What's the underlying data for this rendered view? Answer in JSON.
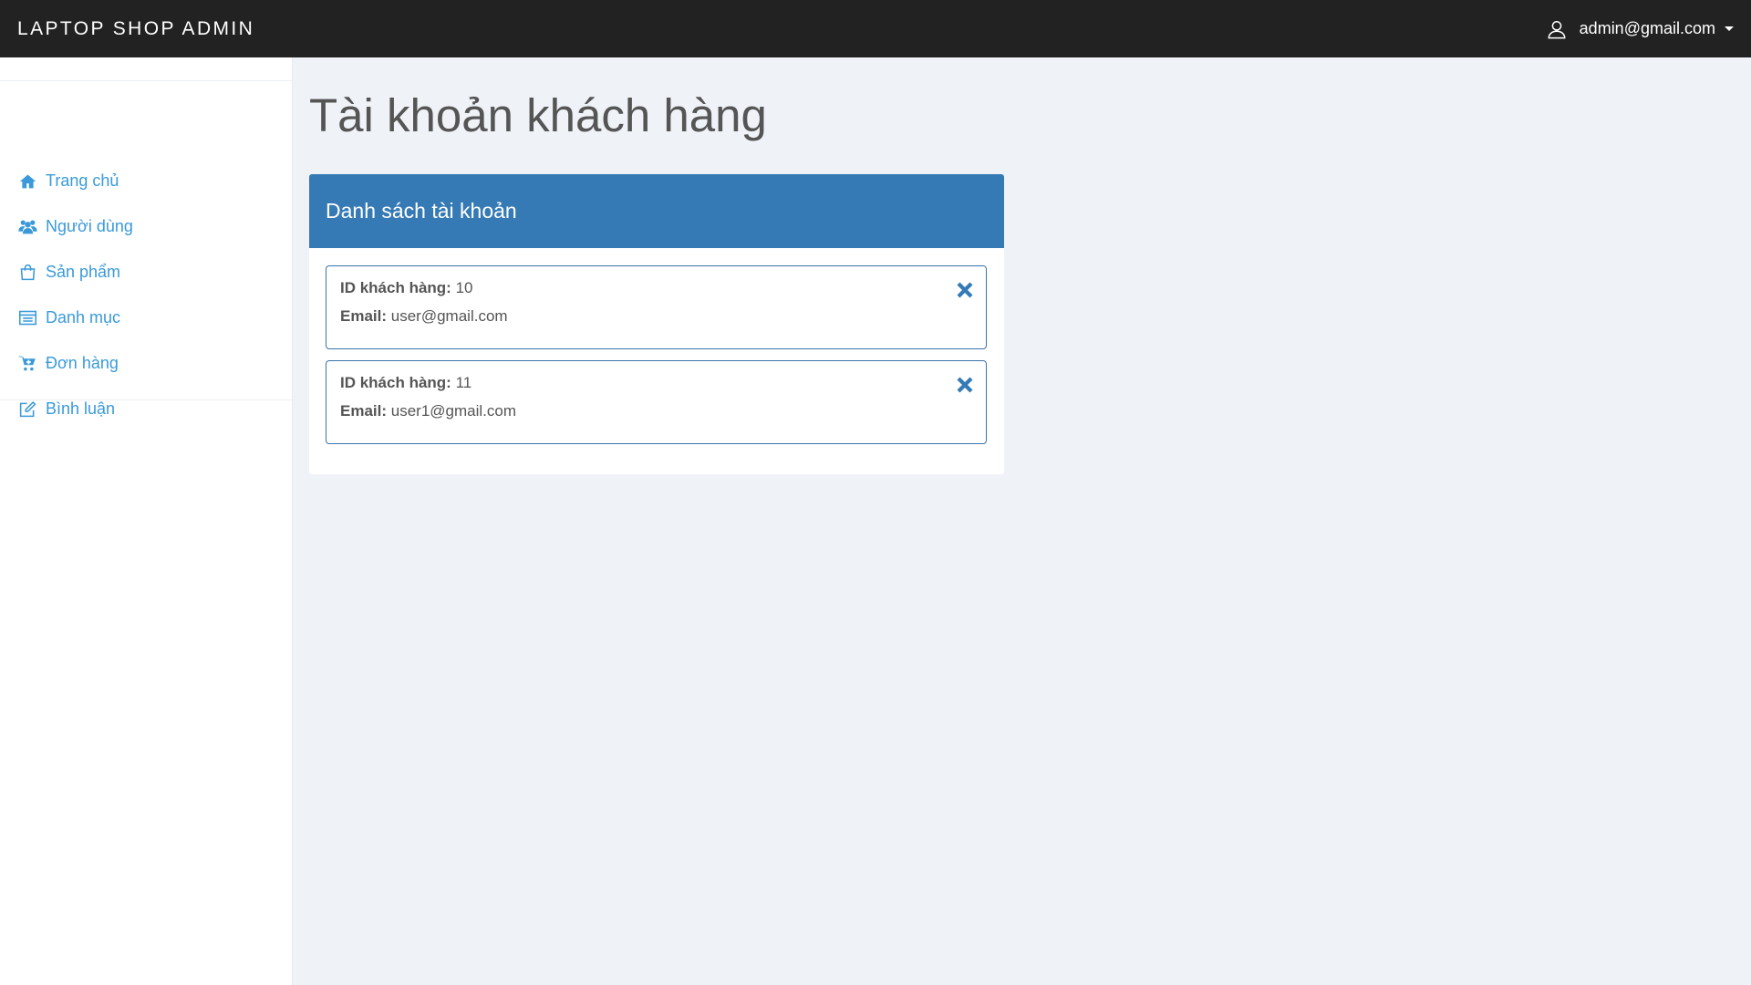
{
  "header": {
    "brand": "LAPTOP SHOP ADMIN",
    "user_email": "admin@gmail.com",
    "user_icon": "user-icon",
    "caret_icon": "caret-down-icon",
    "background_color": "#222222"
  },
  "sidebar": {
    "link_color": "#3a9ad9",
    "items": [
      {
        "label": "Trang chủ",
        "icon": "home-icon"
      },
      {
        "label": "Người dùng",
        "icon": "users-icon"
      },
      {
        "label": "Sản phẩm",
        "icon": "shopping-bag-icon"
      },
      {
        "label": "Danh mục",
        "icon": "list-icon"
      },
      {
        "label": "Đơn hàng",
        "icon": "cart-icon"
      },
      {
        "label": "Bình luận",
        "icon": "edit-icon"
      }
    ]
  },
  "main": {
    "title": "Tài khoản khách hàng",
    "panel": {
      "heading": "Danh sách tài khoản",
      "heading_color": "#367ab5",
      "id_label": "ID khách hàng:",
      "email_label": "Email:",
      "delete_icon": "close-icon",
      "accounts": [
        {
          "id": "10",
          "email": "user@gmail.com"
        },
        {
          "id": "11",
          "email": "user1@gmail.com"
        }
      ]
    }
  }
}
